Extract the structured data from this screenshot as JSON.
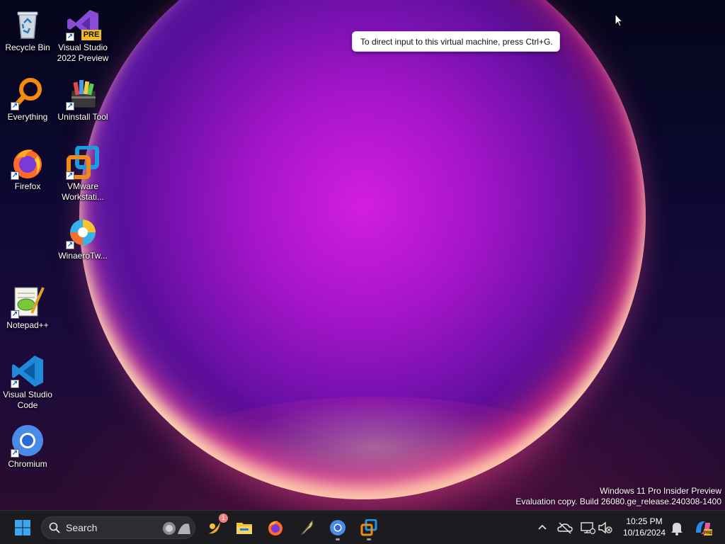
{
  "desktop": {
    "icons": [
      {
        "label": "Recycle Bin",
        "icon": "recycle-bin-icon",
        "shortcut": false
      },
      {
        "label": "Visual Studio 2022 Preview",
        "icon": "visual-studio-icon",
        "badge": "PRE",
        "shortcut": true
      },
      {
        "label": "Everything",
        "icon": "everything-search-icon",
        "shortcut": true
      },
      {
        "label": "Uninstall Tool",
        "icon": "uninstall-tool-icon",
        "shortcut": true
      },
      {
        "label": "Firefox",
        "icon": "firefox-icon",
        "shortcut": true
      },
      {
        "label": "VMware Workstati...",
        "icon": "vmware-icon",
        "shortcut": true
      },
      {
        "label": "WinaeroTw...",
        "icon": "winaero-tweaker-icon",
        "shortcut": true
      },
      {
        "label": "Notepad++",
        "icon": "notepad-plus-plus-icon",
        "shortcut": true
      },
      {
        "label": "Visual Studio Code",
        "icon": "vscode-icon",
        "shortcut": true
      },
      {
        "label": "Chromium",
        "icon": "chromium-icon",
        "shortcut": true
      }
    ]
  },
  "tooltip": {
    "text": "To direct input to this virtual machine, press Ctrl+G."
  },
  "watermark": {
    "line1": "Windows 11 Pro Insider Preview",
    "line2": "Evaluation copy. Build 26080.ge_release.240308-1400"
  },
  "taskbar": {
    "search_placeholder": "Search",
    "pinned": [
      {
        "name": "weather-widget-icon",
        "badge": "1"
      },
      {
        "name": "file-explorer-icon"
      },
      {
        "name": "firefox-icon"
      },
      {
        "name": "feather-app-icon"
      },
      {
        "name": "chromium-icon",
        "running": true
      },
      {
        "name": "vmware-icon",
        "running": true
      }
    ],
    "tray_icons": [
      "chevron-up-icon",
      "onedrive-offline-icon",
      "network-icon",
      "volume-muted-icon",
      "notification-bell-icon",
      "copilot-icon"
    ],
    "clock": {
      "time": "10:25 PM",
      "date": "10/16/2024"
    }
  },
  "colors": {
    "taskbar_bg": "#1c1c20",
    "accent": "#0078d4",
    "wallpaper_orb": "#c21cd8"
  }
}
